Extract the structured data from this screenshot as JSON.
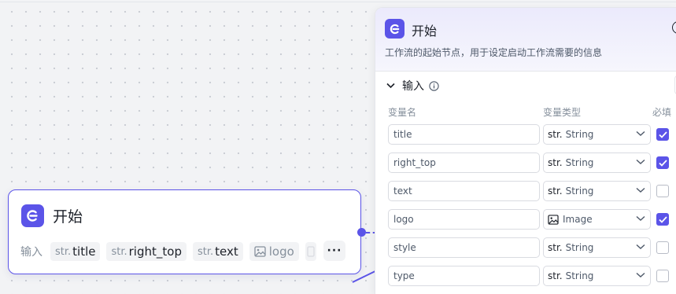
{
  "node": {
    "title": "开始",
    "inputs_label": "输入",
    "tags": [
      {
        "prefix": "str.",
        "name": "title"
      },
      {
        "prefix": "str.",
        "name": "right_top"
      },
      {
        "prefix": "str.",
        "name": "text"
      },
      {
        "prefix": "",
        "name": "logo",
        "icon": "image-icon"
      }
    ],
    "more": "···"
  },
  "panel": {
    "title": "开始",
    "description": "工作流的起始节点，用于设定启动工作流需要的信息",
    "section_title": "输入",
    "columns": {
      "name": "变量名",
      "type": "变量类型",
      "required": "必填"
    },
    "rows": [
      {
        "name": "title",
        "type_prefix": "str.",
        "type": "String",
        "required": true
      },
      {
        "name": "right_top",
        "type_prefix": "str.",
        "type": "String",
        "required": true
      },
      {
        "name": "text",
        "type_prefix": "str.",
        "type": "String",
        "required": false
      },
      {
        "name": "logo",
        "type_prefix": "",
        "type": "Image",
        "type_icon": "image-icon",
        "required": true
      },
      {
        "name": "style",
        "type_prefix": "str.",
        "type": "String",
        "required": false
      },
      {
        "name": "type",
        "type_prefix": "str.",
        "type": "String",
        "required": false
      }
    ]
  },
  "colors": {
    "accent": "#5b54e8",
    "border": "#d9dbe1",
    "muted": "#86909c"
  }
}
